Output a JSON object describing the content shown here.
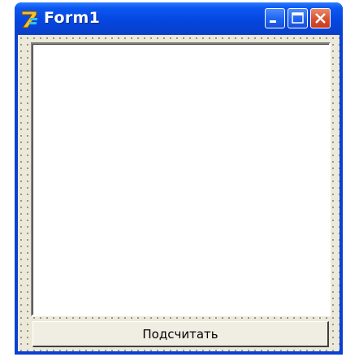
{
  "window": {
    "title": "Form1",
    "icon": "delphi-app-icon",
    "controls": {
      "minimize_icon": "minimize-icon",
      "maximize_icon": "maximize-icon",
      "close_icon": "close-icon"
    }
  },
  "form": {
    "memo_text": "",
    "button_label": "Подсчитать"
  },
  "colors": {
    "titlebar": "#0546e0",
    "client_background": "#ece9d8",
    "close_button": "#d8502f"
  }
}
